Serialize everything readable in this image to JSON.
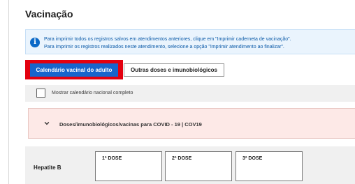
{
  "page": {
    "title": "Vacinação"
  },
  "info": {
    "icon": "info-icon",
    "line1": "Para imprimir todos os registros salvos em atendimentos anteriores, clique em \"Imprimir caderneta de vacinação\".",
    "line2": "Para imprimir os registros realizados neste atendimento, selecione a opção \"Imprimir atendimento ao finalizar\"."
  },
  "tabs": [
    {
      "label": "Calendário vacinal do adulto",
      "active": true
    },
    {
      "label": "Outras doses e imunobiológicos",
      "active": false
    }
  ],
  "options": {
    "show_full_calendar_label": "Mostrar calendário nacional completo",
    "checked": false
  },
  "covid_section": {
    "icon": "chevron-down-icon",
    "label": "Doses/imunobiológicos/vacinas para COVID - 19 | COV19"
  },
  "vaccines": [
    {
      "name": "Hepatite B",
      "doses": [
        "1ª DOSE",
        "2ª DOSE",
        "3ª DOSE"
      ]
    }
  ],
  "colors": {
    "accent": "#1765cc",
    "highlight": "#e3000f",
    "info_bg": "#eaf4fd",
    "covid_bg": "#fde9e7"
  }
}
